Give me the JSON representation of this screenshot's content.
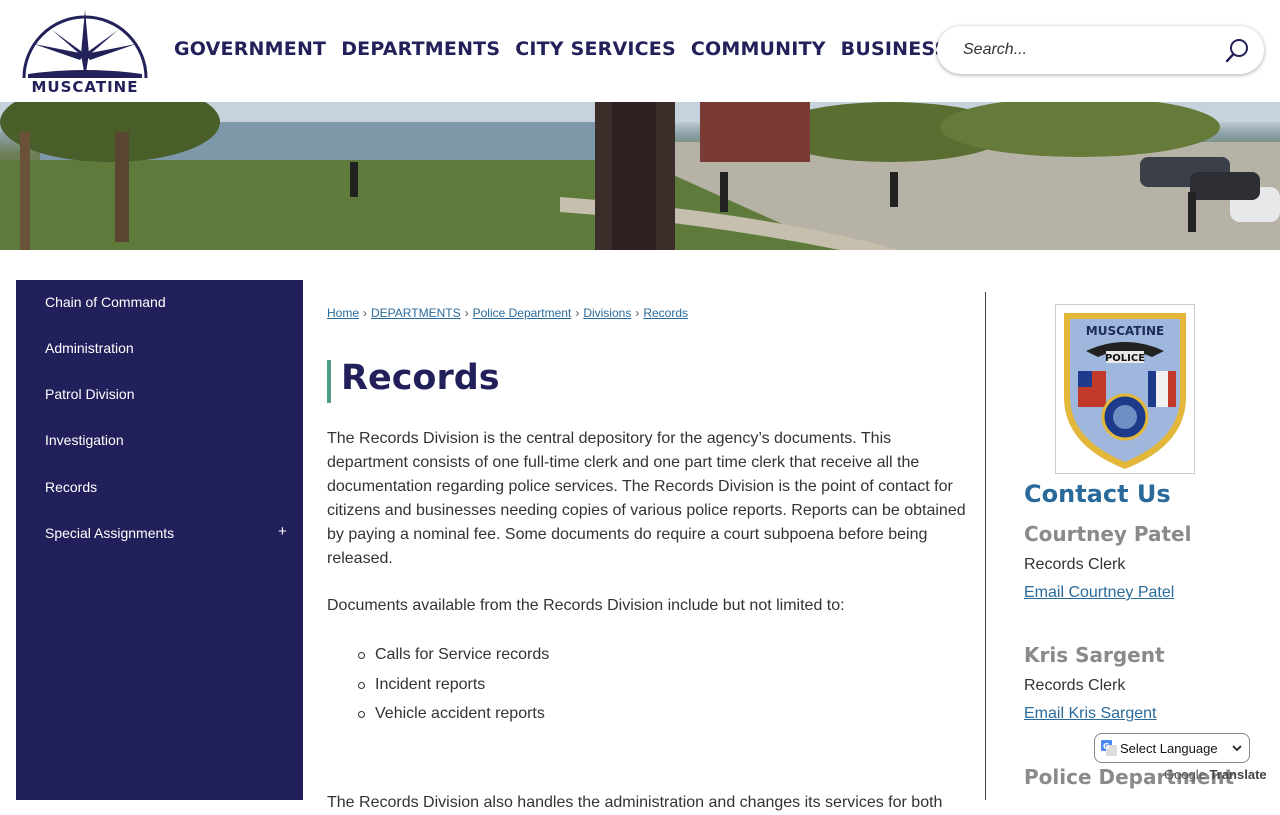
{
  "header": {
    "logo_text": "MUSCATINE",
    "nav": [
      "GOVERNMENT",
      "DEPARTMENTS",
      "CITY SERVICES",
      "COMMUNITY",
      "BUSINESS"
    ],
    "search_placeholder": "Search..."
  },
  "sidebar": {
    "items": [
      {
        "label": "Chain of Command"
      },
      {
        "label": "Administration"
      },
      {
        "label": "Patrol Division"
      },
      {
        "label": "Investigation"
      },
      {
        "label": "Records"
      },
      {
        "label": "Special Assignments",
        "expand": "+"
      }
    ]
  },
  "breadcrumb": [
    "Home",
    "DEPARTMENTS",
    "Police Department",
    "Divisions",
    "Records"
  ],
  "breadcrumb_sep": "›",
  "main": {
    "title": "Records",
    "para1": "The Records Division is the central depository for the agency’s documents. This department consists of one full-time clerk and one part time clerk that receive all the documentation regarding police services. The Records Division is the point of contact for citizens and businesses needing copies of various police reports. Reports can be obtained by paying a nominal fee. Some documents do require a court subpoena before being released.",
    "para2": "Documents available from the Records Division include but not limited to:",
    "bullets": [
      "Calls for Service records",
      "Incident reports",
      "Vehicle accident reports"
    ],
    "para3_partial": "The Records Division also handles the administration and changes its services for both"
  },
  "contact": {
    "badge_text_top": "MUSCATINE",
    "badge_text_mid": "POLICE",
    "title": "Contact Us",
    "people": [
      {
        "name": "Courtney Patel",
        "role": "Records Clerk",
        "email": "Email Courtney Patel"
      },
      {
        "name": "Kris Sargent",
        "role": "Records Clerk",
        "email": "Email Kris Sargent"
      }
    ],
    "dept_title": "Police Department"
  },
  "translate": {
    "label": "Select Language",
    "powered_by": "Google",
    "powered_word": "Translate"
  },
  "colors": {
    "navy": "#22205a",
    "link": "#2a6a9b",
    "accent_bar": "#4d9c88",
    "name_gray": "#8a8a8a"
  }
}
